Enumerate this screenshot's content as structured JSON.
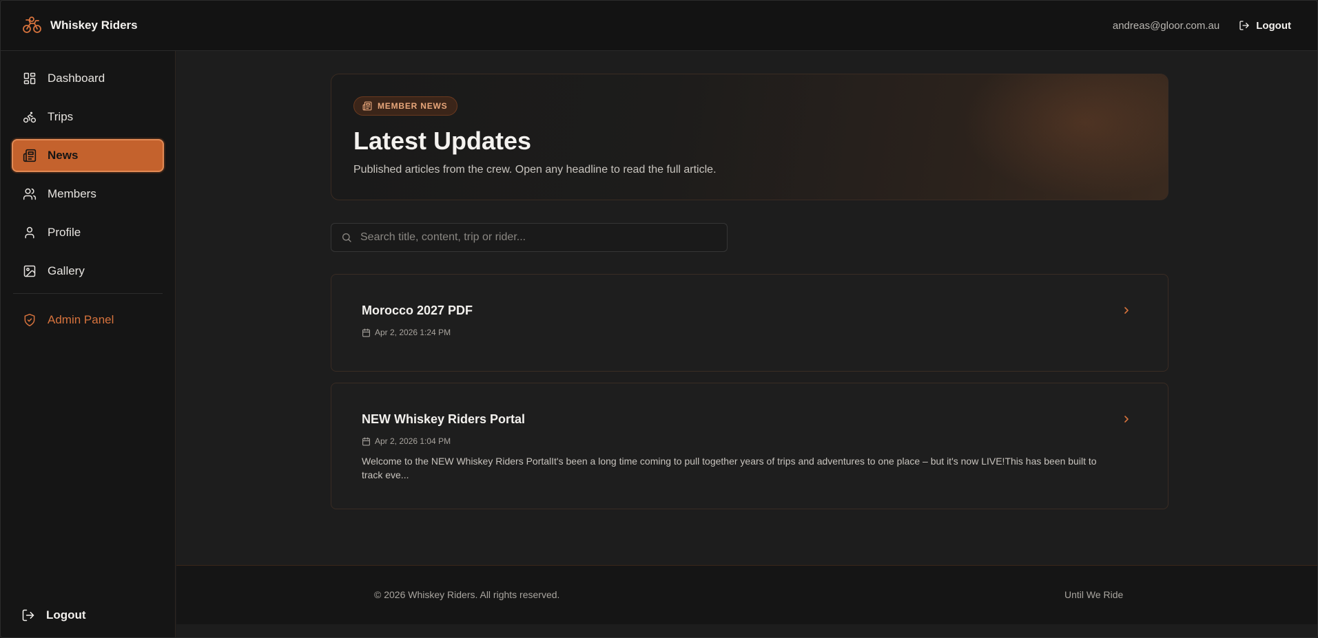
{
  "header": {
    "brand_name": "Whiskey Riders",
    "user_email": "andreas@gloor.com.au",
    "logout_label": "Logout"
  },
  "sidebar": {
    "items": [
      {
        "label": "Dashboard",
        "icon": "dashboard-icon"
      },
      {
        "label": "Trips",
        "icon": "bicycle-icon"
      },
      {
        "label": "News",
        "icon": "newspaper-icon",
        "active": true
      },
      {
        "label": "Members",
        "icon": "users-icon"
      },
      {
        "label": "Profile",
        "icon": "user-icon"
      },
      {
        "label": "Gallery",
        "icon": "image-icon"
      }
    ],
    "admin_label": "Admin Panel",
    "logout_label": "Logout"
  },
  "hero": {
    "badge": "MEMBER NEWS",
    "title": "Latest Updates",
    "subtitle": "Published articles from the crew. Open any headline to read the full article."
  },
  "search": {
    "placeholder": "Search title, content, trip or rider..."
  },
  "articles": [
    {
      "title": "Morocco 2027 PDF",
      "date": "Apr 2, 2026 1:24 PM",
      "excerpt": ""
    },
    {
      "title": "NEW Whiskey Riders Portal",
      "date": "Apr 2, 2026 1:04 PM",
      "excerpt": "Welcome to the NEW Whiskey Riders PortalIt's been a long time coming to pull together years of trips and adventures to one place – but it's now LIVE!This has been built to track eve..."
    }
  ],
  "footer": {
    "copyright": "© 2026 Whiskey Riders. All rights reserved.",
    "tagline": "Until We Ride"
  },
  "colors": {
    "accent": "#c4622d",
    "accent_text": "#d7733d",
    "background": "#1c1c1c",
    "sidebar": "#151515"
  }
}
